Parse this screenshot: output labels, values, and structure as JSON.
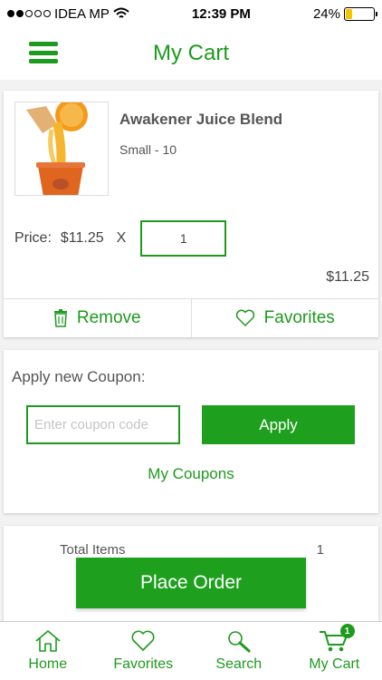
{
  "status_bar": {
    "carrier": "IDEA MP",
    "time": "12:39 PM",
    "battery_text": "24%",
    "battery_level": 0.24
  },
  "header": {
    "title": "My Cart",
    "menu_icon": "hamburger-menu-icon"
  },
  "cart_item": {
    "name": "Awakener Juice Blend",
    "variant": "Small - 10",
    "price_label": "Price:",
    "price": "$11.25",
    "multiply": "X",
    "quantity": "1",
    "line_total": "$11.25",
    "remove_label": "Remove",
    "favorites_label": "Favorites"
  },
  "coupon": {
    "title": "Apply new Coupon:",
    "placeholder": "Enter coupon code",
    "apply_label": "Apply",
    "my_coupons_label": "My Coupons"
  },
  "summary": {
    "total_items_label": "Total Items",
    "total_items_value": "1"
  },
  "place_order_label": "Place Order",
  "tabs": [
    {
      "label": "Home",
      "icon": "home-icon"
    },
    {
      "label": "Favorites",
      "icon": "heart-icon"
    },
    {
      "label": "Search",
      "icon": "search-icon"
    },
    {
      "label": "My Cart",
      "icon": "cart-icon",
      "badge": "1"
    }
  ],
  "colors": {
    "accent": "#1e9a1e",
    "button": "#1ea01e",
    "battery": "#f5c400"
  }
}
